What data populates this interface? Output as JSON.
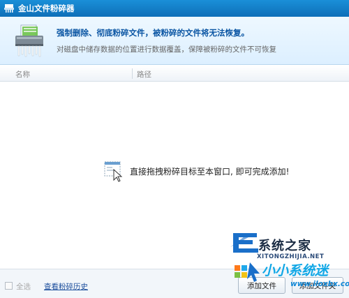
{
  "window": {
    "title": "金山文件粉碎器"
  },
  "header": {
    "headline": "强制删除、彻底粉碎文件，被粉碎的文件将无法恢复。",
    "subline": "对磁盘中储存数据的位置进行数据覆盖，保障被粉碎的文件不可恢复"
  },
  "table": {
    "columns": [
      "名称",
      "路径"
    ],
    "rows": []
  },
  "list": {
    "empty_hint": "直接拖拽粉碎目标至本窗口, 即可完成添加!"
  },
  "footer": {
    "select_all_label": "全选",
    "select_all_checked": false,
    "history_link": "查看粉碎历史",
    "add_file_button": "添加文件",
    "add_folder_button": "添加文件夹"
  },
  "watermark": {
    "brand": "系统之家",
    "url": "XITONGZHIJIA.NET",
    "brand2": "小小系统迷",
    "url2": "www.iloxbx.com"
  },
  "colors": {
    "titlebar": "#1383cc",
    "headline": "#0a55a3",
    "link": "#1c4e9c",
    "watermark_blue": "#10a7e6"
  }
}
